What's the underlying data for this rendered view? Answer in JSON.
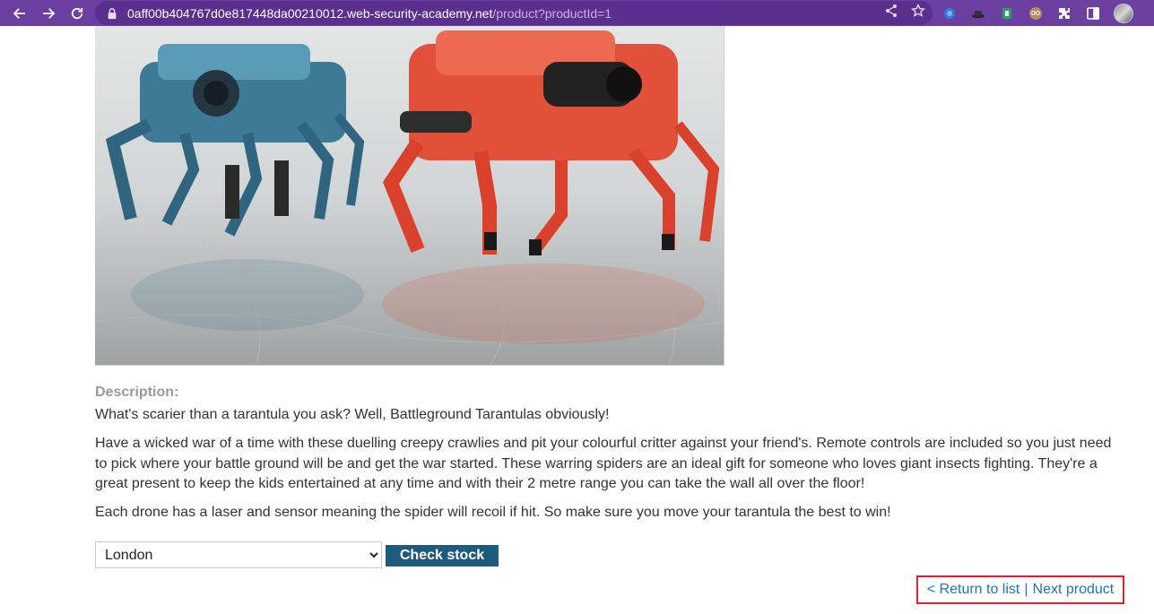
{
  "browser": {
    "url_host": "0aff00b404767d0e817448da00210012.web-security-academy.net",
    "url_path": "/product?productId=1",
    "chrome_color": "#6b3fa0"
  },
  "product": {
    "image_alt": "Battleground Tarantulas",
    "description_label": "Description:",
    "paragraphs": [
      "What's scarier than a tarantula you ask? Well, Battleground Tarantulas obviously!",
      "Have a wicked war of a time with these duelling creepy crawlies and pit your colourful critter against your friend's. Remote controls are included so you just need to pick where your battle ground will be and get the war started. These warring spiders are an ideal gift for someone who loves giant insects fighting. They're a great present to keep the kids entertained at any time and with their 2 metre range you can take the wall all over the floor!",
      "Each drone has a laser and sensor meaning the spider will recoil if hit. So make sure you move your tarantula the best to win!"
    ]
  },
  "stock": {
    "selected_store": "London",
    "check_label": "Check stock",
    "button_color": "#1d5b7e"
  },
  "navigation": {
    "return_label": "< Return to list",
    "separator": "|",
    "next_label": "Next product",
    "link_color": "#1e73b8",
    "highlight_color": "#e5202a"
  }
}
